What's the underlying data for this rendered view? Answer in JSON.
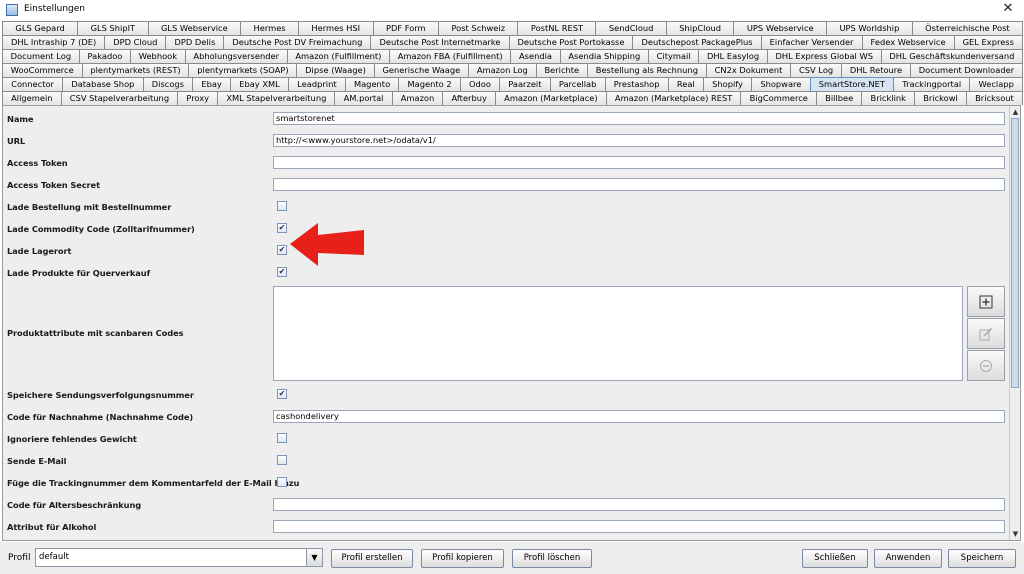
{
  "window": {
    "title": "Einstellungen",
    "close_label": "✕"
  },
  "tab_rows": [
    [
      "GLS Gepard",
      "GLS ShipIT",
      "GLS Webservice",
      "Hermes",
      "Hermes HSI",
      "PDF Form",
      "Post Schweiz",
      "PostNL REST",
      "SendCloud",
      "ShipCloud",
      "UPS Webservice",
      "UPS Worldship",
      "Österreichische Post"
    ],
    [
      "DHL Intraship 7 (DE)",
      "DPD Cloud",
      "DPD Delis",
      "Deutsche Post DV Freimachung",
      "Deutsche Post Internetmarke",
      "Deutsche Post Portokasse",
      "Deutschepost PackagePlus",
      "Einfacher Versender",
      "Fedex Webservice",
      "GEL Express"
    ],
    [
      "Document Log",
      "Pakadoo",
      "Webhook",
      "Abholungsversender",
      "Amazon (Fulfillment)",
      "Amazon FBA (Fulfillment)",
      "Asendia",
      "Asendia Shipping",
      "Citymail",
      "DHL Easylog",
      "DHL Express Global WS",
      "DHL Geschäftskundenversand"
    ],
    [
      "WooCommerce",
      "plentymarkets (REST)",
      "plentymarkets (SOAP)",
      "Dipse (Waage)",
      "Generische Waage",
      "Amazon Log",
      "Berichte",
      "Bestellung als Rechnung",
      "CN2x Dokument",
      "CSV Log",
      "DHL Retoure",
      "Document Downloader"
    ],
    [
      "Connector",
      "Database Shop",
      "Discogs",
      "Ebay",
      "Ebay XML",
      "Leadprint",
      "Magento",
      "Magento 2",
      "Odoo",
      "Paarzeit",
      "Parcellab",
      "Prestashop",
      "Real",
      "Shopify",
      "Shopware",
      "SmartStore.NET",
      "Trackingportal",
      "Weclapp"
    ],
    [
      "Allgemein",
      "CSV Stapelverarbeitung",
      "Proxy",
      "XML Stapelverarbeitung",
      "AM.portal",
      "Amazon",
      "Afterbuy",
      "Amazon (Marketplace)",
      "Amazon (Marketplace) REST",
      "BigCommerce",
      "Billbee",
      "Bricklink",
      "Brickowl",
      "Bricksout"
    ]
  ],
  "active_tab": "SmartStore.NET",
  "settings": [
    {
      "label": "Name",
      "type": "text",
      "value": "smartstorenet"
    },
    {
      "label": "URL",
      "type": "text",
      "value": "http://<www.yourstore.net>/odata/v1/"
    },
    {
      "label": "Access Token",
      "type": "text",
      "value": ""
    },
    {
      "label": "Access Token Secret",
      "type": "text",
      "value": ""
    },
    {
      "label": "Lade Bestellung mit Bestellnummer",
      "type": "checkbox",
      "checked": false
    },
    {
      "label": "Lade Commodity Code (Zolltarifnummer)",
      "type": "checkbox",
      "checked": true
    },
    {
      "label": "Lade Lagerort",
      "type": "checkbox",
      "checked": true
    },
    {
      "label": "Lade Produkte für Querverkauf",
      "type": "checkbox",
      "checked": true
    },
    {
      "label": "Produktattribute mit scanbaren Codes",
      "type": "list",
      "items": []
    },
    {
      "label": "Speichere Sendungsverfolgungsnummer",
      "type": "checkbox",
      "checked": true
    },
    {
      "label": "Code für Nachnahme (Nachnahme Code)",
      "type": "text",
      "value": "cashondelivery"
    },
    {
      "label": "Ignoriere fehlendes Gewicht",
      "type": "checkbox",
      "checked": false
    },
    {
      "label": "Sende E-Mail",
      "type": "checkbox",
      "checked": false
    },
    {
      "label": "Füge die Trackingnummer dem Kommentarfeld der E-Mail hinzu",
      "type": "checkbox",
      "checked": false
    },
    {
      "label": "Code für Altersbeschränkung",
      "type": "text",
      "value": ""
    },
    {
      "label": "Attribut für Alkohol",
      "type": "text",
      "value": ""
    }
  ],
  "list_buttons": [
    "plus-icon",
    "edit-icon",
    "minus-icon"
  ],
  "annotation": {
    "icon": "red-arrow-icon",
    "color": "#e8201a"
  },
  "bottom": {
    "profile_label": "Profil",
    "profile_value": "default",
    "buttons": {
      "create": "Profil erstellen",
      "copy": "Profil kopieren",
      "delete": "Profil löschen",
      "close": "Schließen",
      "apply": "Anwenden",
      "save": "Speichern"
    }
  },
  "colors": {
    "active_tab": "#d7e4f3",
    "panel": "#eeeeee",
    "arrow": "#e8201a"
  }
}
